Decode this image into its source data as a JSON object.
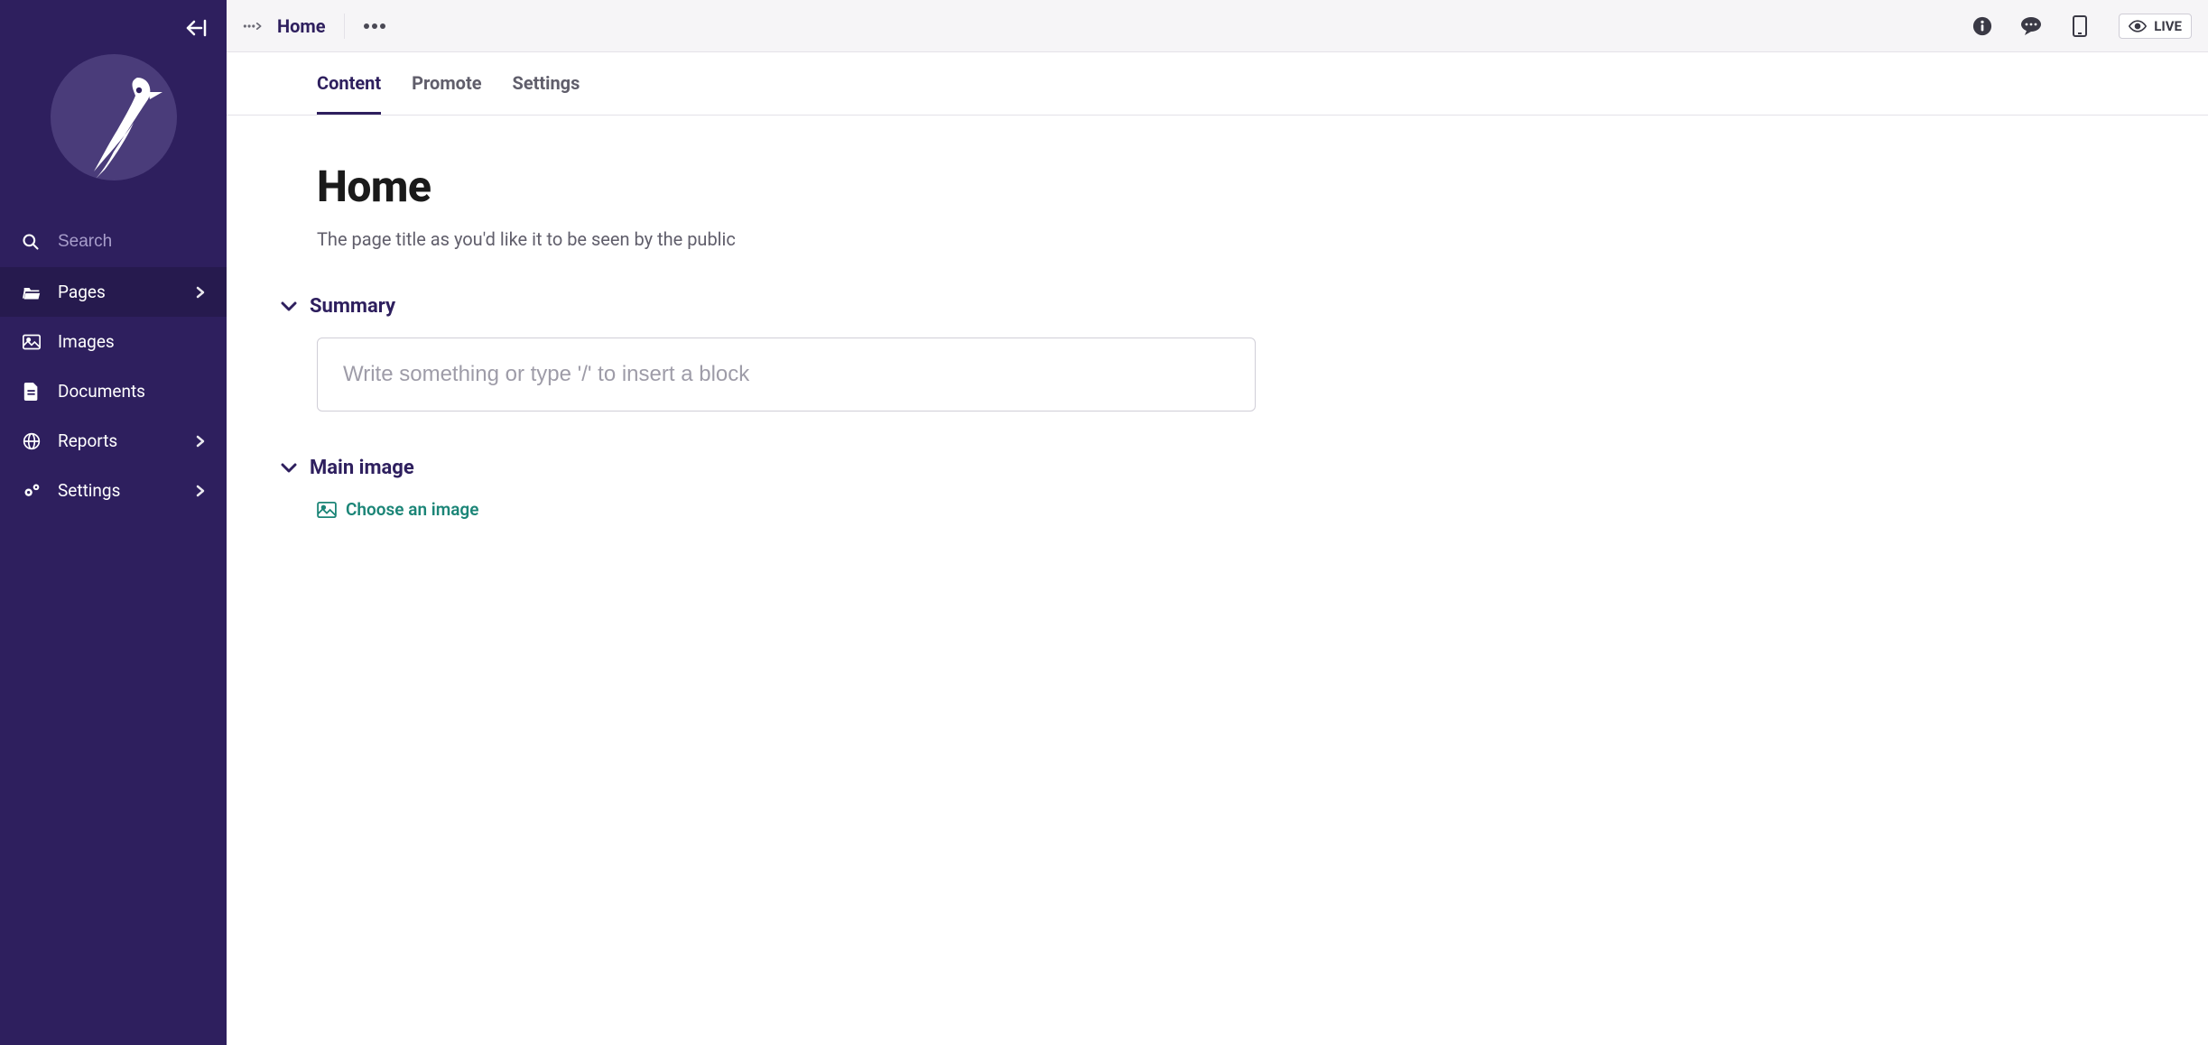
{
  "sidebar": {
    "search_placeholder": "Search",
    "items": [
      {
        "icon": "folder-open-icon",
        "label": "Pages",
        "has_children": true,
        "active": true
      },
      {
        "icon": "image-icon",
        "label": "Images",
        "has_children": false,
        "active": false
      },
      {
        "icon": "document-icon",
        "label": "Documents",
        "has_children": false,
        "active": false
      },
      {
        "icon": "globe-icon",
        "label": "Reports",
        "has_children": true,
        "active": false
      },
      {
        "icon": "cogs-icon",
        "label": "Settings",
        "has_children": true,
        "active": false
      }
    ]
  },
  "topbar": {
    "breadcrumb_title": "Home",
    "live_label": "LIVE"
  },
  "tabs": [
    {
      "label": "Content",
      "active": true
    },
    {
      "label": "Promote",
      "active": false
    },
    {
      "label": "Settings",
      "active": false
    }
  ],
  "page": {
    "title": "Home",
    "subtitle": "The page title as you'd like it to be seen by the public"
  },
  "sections": {
    "summary": {
      "title": "Summary",
      "placeholder": "Write something or type '/' to insert a block"
    },
    "main_image": {
      "title": "Main image",
      "choose_label": "Choose an image"
    }
  }
}
